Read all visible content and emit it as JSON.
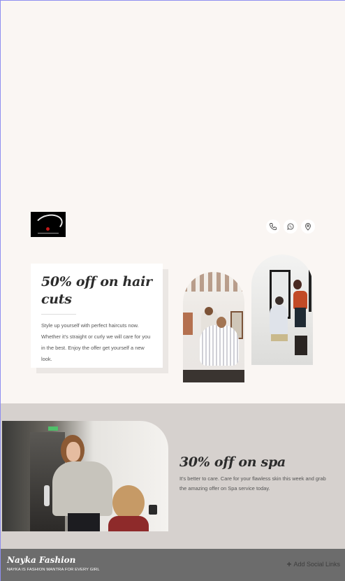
{
  "header": {
    "logo_icon": "salon-logo-icon",
    "contact_icons": [
      "phone-icon",
      "whatsapp-icon",
      "location-pin-icon"
    ]
  },
  "offers": {
    "haircut": {
      "title": "50% off on hair cuts",
      "body": "Style up yourself with perfect haircuts now. Whether it's straight or curly we will care for you in the best. Enjoy the offer get yourself a new look."
    },
    "spa": {
      "title": "30% off on spa",
      "body": "It's better to care. Care for your flawless skin this week and grab the amazing offer on Spa service today."
    }
  },
  "footer": {
    "brand": "Nayka Fashion",
    "tagline": "NAYKA IS FASHION MANTRA FOR EVERY GIRL",
    "social_label": "Add Social Links",
    "social_icon": "plus-icon"
  },
  "colors": {
    "page_bg": "#faf6f3",
    "spa_bg": "#d6d1ce",
    "footer_bg": "#6c6c6c"
  }
}
